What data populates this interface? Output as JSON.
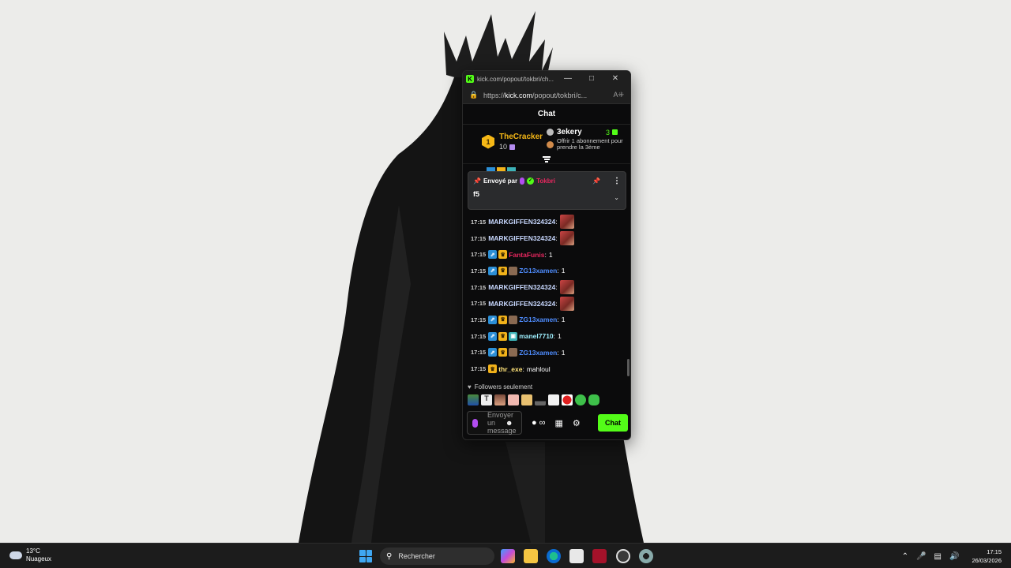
{
  "browser": {
    "tab_title": "kick.com/popout/tokbri/ch...",
    "url_prefix": "https://",
    "url_domain": "kick.com",
    "url_path": "/popout/tokbri/c...",
    "minimize_icon": "minimize-icon",
    "maximize_icon": "maximize-icon",
    "close_icon": "close-icon"
  },
  "chat": {
    "header": "Chat",
    "leaderboard": {
      "first": {
        "rank": "1",
        "name": "TheCracker",
        "count": "10"
      },
      "second": {
        "name": "3ekery",
        "count": "3",
        "offer": "Offrir 1 abonnement pour prendre la 3ème"
      }
    },
    "pinned": {
      "sent_by_label": "Envoyé par",
      "user": "Tokbri",
      "message": "f5"
    },
    "messages": [
      {
        "time": "17:15",
        "badges": [],
        "user": "MARKGIFFEN324324",
        "user_color": "#c8d8ff",
        "text": "",
        "emote": true
      },
      {
        "time": "17:15",
        "badges": [],
        "user": "MARKGIFFEN324324",
        "user_color": "#c8d8ff",
        "text": "",
        "emote": true
      },
      {
        "time": "17:15",
        "badges": [
          "sub",
          "vip"
        ],
        "user": "FantaFunis",
        "user_color": "#e8275f",
        "text": "1",
        "emote": false
      },
      {
        "time": "17:15",
        "badges": [
          "sub",
          "vip",
          "face"
        ],
        "user": "ZG13xamen",
        "user_color": "#4f8dff",
        "text": "1",
        "emote": false
      },
      {
        "time": "17:15",
        "badges": [],
        "user": "MARKGIFFEN324324",
        "user_color": "#c8d8ff",
        "text": "",
        "emote": true
      },
      {
        "time": "17:15",
        "badges": [],
        "user": "MARKGIFFEN324324",
        "user_color": "#c8d8ff",
        "text": "",
        "emote": true
      },
      {
        "time": "17:15",
        "badges": [
          "sub",
          "vip",
          "face"
        ],
        "user": "ZG13xamen",
        "user_color": "#4f8dff",
        "text": "1",
        "emote": false
      },
      {
        "time": "17:15",
        "badges": [
          "sub",
          "vip",
          "game"
        ],
        "user": "manel7710",
        "user_color": "#9ef0ff",
        "text": "1",
        "emote": false
      },
      {
        "time": "17:15",
        "badges": [
          "sub",
          "vip",
          "face"
        ],
        "user": "ZG13xamen",
        "user_color": "#4f8dff",
        "text": "1",
        "emote": false
      },
      {
        "time": "17:15",
        "badges": [
          "vip"
        ],
        "user": "thr_exe",
        "user_color": "#ffe37a",
        "text": "mahloul",
        "emote": false
      }
    ],
    "followers_only": "Followers seulement",
    "input_placeholder": "Envoyer un message",
    "send_button": "Chat"
  },
  "taskbar": {
    "temperature": "13°C",
    "condition": "Nuageux",
    "search_label": "Rechercher",
    "time": "17:15",
    "date": "26/03/2026"
  }
}
